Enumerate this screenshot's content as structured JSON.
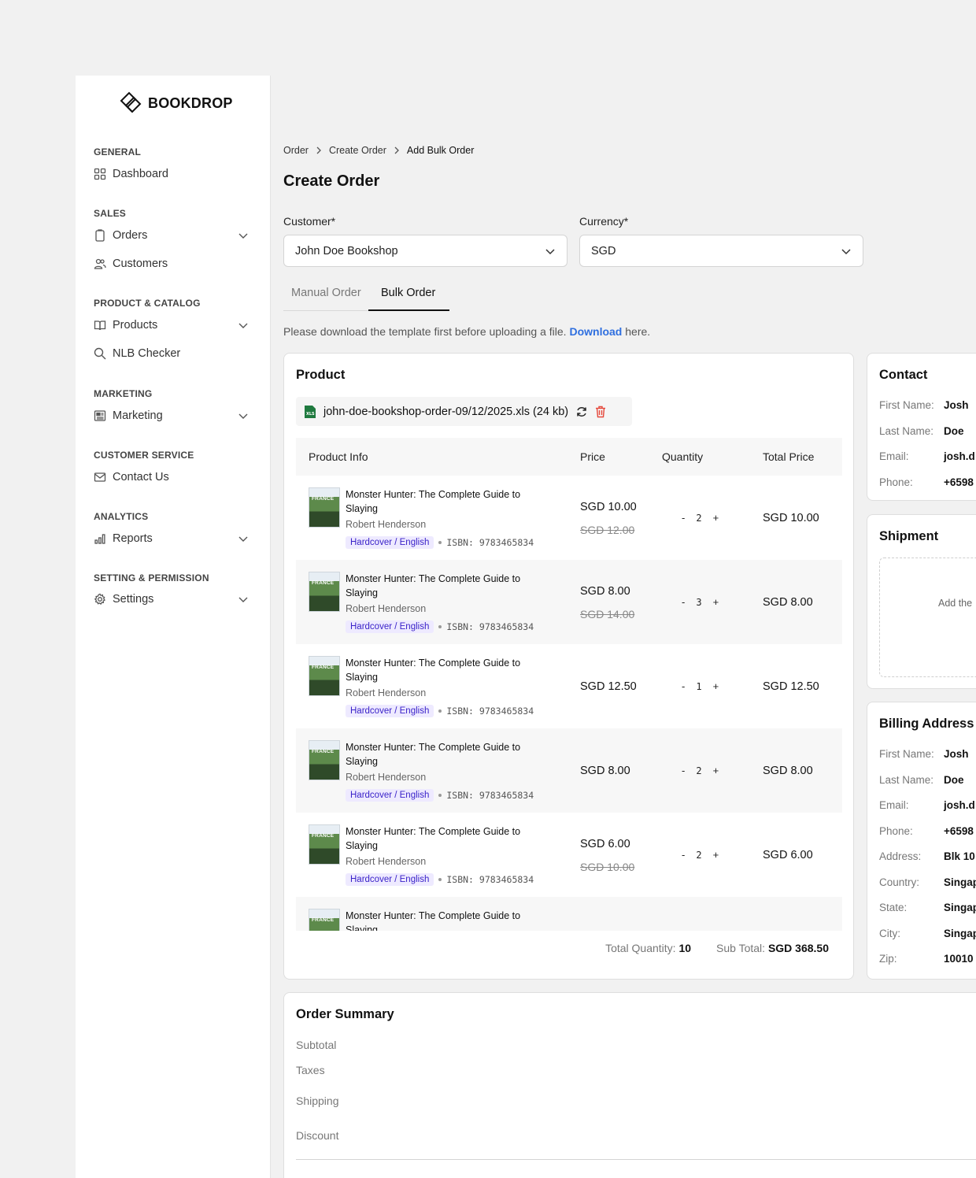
{
  "sidebar": {
    "brand": "BOOKDROP",
    "sections": [
      {
        "title": "GENERAL",
        "items": [
          {
            "label": "Dashboard",
            "icon": "grid-icon",
            "expandable": false
          }
        ]
      },
      {
        "title": "SALES",
        "items": [
          {
            "label": "Orders",
            "icon": "clipboard-icon",
            "expandable": true
          },
          {
            "label": "Customers",
            "icon": "users-icon",
            "expandable": false
          }
        ]
      },
      {
        "title": "PRODUCT & CATALOG",
        "items": [
          {
            "label": "Products",
            "icon": "book-icon",
            "expandable": true
          },
          {
            "label": "NLB Checker",
            "icon": "search-icon",
            "expandable": false
          }
        ]
      },
      {
        "title": "MARKETING",
        "items": [
          {
            "label": "Marketing",
            "icon": "newspaper-icon",
            "expandable": true
          }
        ]
      },
      {
        "title": "CUSTOMER SERVICE",
        "items": [
          {
            "label": "Contact Us",
            "icon": "mail-icon",
            "expandable": false
          }
        ]
      },
      {
        "title": "ANALYTICS",
        "items": [
          {
            "label": "Reports",
            "icon": "bar-chart-icon",
            "expandable": true
          }
        ]
      },
      {
        "title": "SETTING & PERMISSION",
        "items": [
          {
            "label": "Settings",
            "icon": "gear-icon",
            "expandable": true
          }
        ]
      }
    ]
  },
  "breadcrumb": [
    "Order",
    "Create Order",
    "Add Bulk Order"
  ],
  "page_title": "Create Order",
  "form": {
    "customer_label": "Customer*",
    "customer_value": "John Doe Bookshop",
    "currency_label": "Currency*",
    "currency_value": "SGD"
  },
  "tabs": {
    "manual": "Manual Order",
    "bulk": "Bulk Order",
    "active": "bulk"
  },
  "hint": {
    "before": "Please download the template first before uploading a file.",
    "link": "Download",
    "after": "here."
  },
  "product_card": {
    "title": "Product",
    "file": "john-doe-bookshop-order-09/12/2025.xls (24 kb)",
    "columns": [
      "Product Info",
      "Price",
      "Quantity",
      "Total Price"
    ],
    "rows": [
      {
        "title": "Monster Hunter: The Complete Guide to Slaying",
        "author": "Robert Henderson",
        "format": "Hardcover / English",
        "isbn": "ISBN: 9783465834",
        "price": "SGD 10.00",
        "old_price": "SGD 12.00",
        "qty": "2",
        "total": "SGD 10.00"
      },
      {
        "title": "Monster Hunter: The Complete Guide to Slaying",
        "author": "Robert Henderson",
        "format": "Hardcover / English",
        "isbn": "ISBN: 9783465834",
        "price": "SGD 8.00",
        "old_price": "SGD 14.00",
        "qty": "3",
        "total": "SGD 8.00"
      },
      {
        "title": "Monster Hunter: The Complete Guide to Slaying",
        "author": "Robert Henderson",
        "format": "Hardcover / English",
        "isbn": "ISBN: 9783465834",
        "price": "SGD 12.50",
        "old_price": "",
        "qty": "1",
        "total": "SGD 12.50"
      },
      {
        "title": "Monster Hunter: The Complete Guide to Slaying",
        "author": "Robert Henderson",
        "format": "Hardcover / English",
        "isbn": "ISBN: 9783465834",
        "price": "SGD 8.00",
        "old_price": "",
        "qty": "2",
        "total": "SGD 8.00"
      },
      {
        "title": "Monster Hunter: The Complete Guide to Slaying",
        "author": "Robert Henderson",
        "format": "Hardcover / English",
        "isbn": "ISBN: 9783465834",
        "price": "SGD 6.00",
        "old_price": "SGD 10.00",
        "qty": "2",
        "total": "SGD 6.00"
      },
      {
        "title": "Monster Hunter: The Complete Guide to Slaying",
        "author": "",
        "format": "",
        "isbn": "",
        "price": "",
        "old_price": "",
        "qty": "",
        "total": ""
      }
    ],
    "total_quantity_label": "Total Quantity:",
    "total_quantity": "10",
    "subtotal_label": "Sub Total:",
    "subtotal": "SGD 368.50"
  },
  "contact_card": {
    "title": "Contact",
    "fields": [
      {
        "k": "First Name:",
        "v": "Josh"
      },
      {
        "k": "Last Name:",
        "v": "Doe"
      },
      {
        "k": "Email:",
        "v": "josh.d"
      },
      {
        "k": "Phone:",
        "v": "+6598"
      }
    ]
  },
  "shipment_card": {
    "title": "Shipment",
    "placeholder": "Add the"
  },
  "billing_card": {
    "title": "Billing Address",
    "fields": [
      {
        "k": "First Name:",
        "v": "Josh"
      },
      {
        "k": "Last Name:",
        "v": "Doe"
      },
      {
        "k": "Email:",
        "v": "josh.d"
      },
      {
        "k": "Phone:",
        "v": "+6598"
      },
      {
        "k": "Address:",
        "v": "Blk 10"
      },
      {
        "k": "Country:",
        "v": "Singap"
      },
      {
        "k": "State:",
        "v": "Singap"
      },
      {
        "k": "City:",
        "v": "Singap"
      },
      {
        "k": "Zip:",
        "v": "10010"
      }
    ]
  },
  "summary_card": {
    "title": "Order Summary",
    "rows": [
      "Subtotal",
      "Taxes",
      "Shipping",
      "Discount"
    ]
  },
  "colors": {
    "accent_link": "#2f6fdf",
    "tag_bg": "#eeeaff",
    "tag_text": "#3a22c9",
    "delete": "#e5483b"
  }
}
